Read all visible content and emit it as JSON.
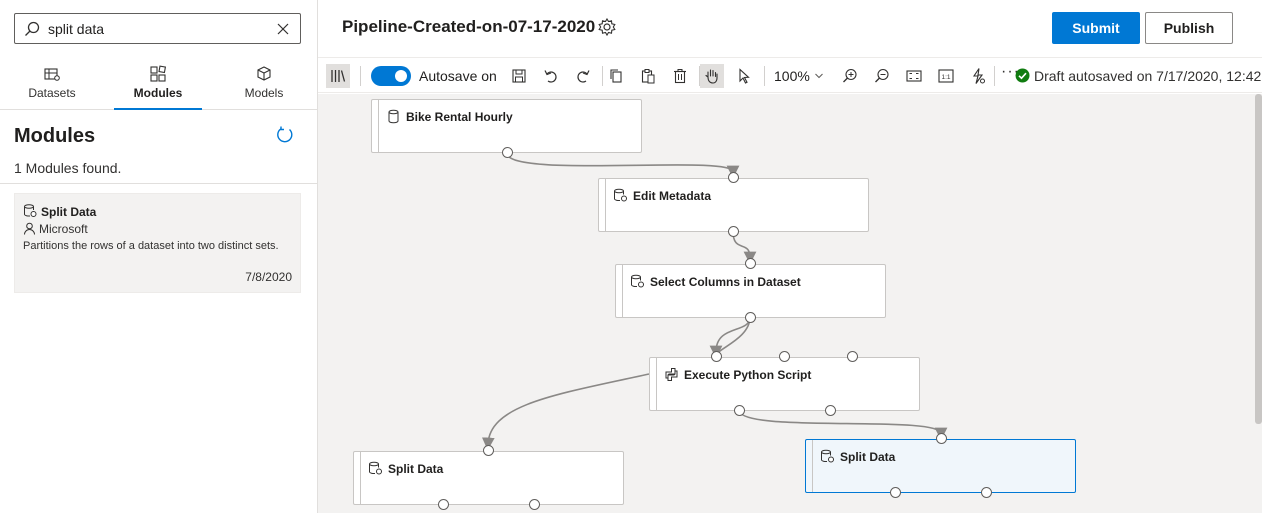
{
  "search": {
    "value": "split data"
  },
  "tabs": [
    {
      "label": "Datasets",
      "icon": "dataset-icon"
    },
    {
      "label": "Modules",
      "icon": "modules-icon"
    },
    {
      "label": "Models",
      "icon": "cube-icon"
    }
  ],
  "modules_panel": {
    "title": "Modules",
    "count_text": "1 Modules found.",
    "items": [
      {
        "name": "Split Data",
        "publisher": "Microsoft",
        "description": "Partitions the rows of a dataset into two distinct sets.",
        "date": "7/8/2020"
      }
    ]
  },
  "header": {
    "title": "Pipeline-Created-on-07-17-2020",
    "submit_label": "Submit",
    "publish_label": "Publish"
  },
  "toolbar": {
    "autosave_label": "Autosave on",
    "autosave_on": true,
    "zoom": "100%",
    "more": "···",
    "status": "Draft autosaved on 7/17/2020, 12:42"
  },
  "canvas": {
    "nodes": [
      {
        "id": "n1",
        "label": "Bike Rental Hourly",
        "icon": "dataset-icon"
      },
      {
        "id": "n2",
        "label": "Edit Metadata",
        "icon": "module-icon"
      },
      {
        "id": "n3",
        "label": "Select Columns in Dataset",
        "icon": "module-icon"
      },
      {
        "id": "n4",
        "label": "Execute Python Script",
        "icon": "python-icon"
      },
      {
        "id": "n5",
        "label": "Split Data",
        "icon": "module-icon"
      },
      {
        "id": "n6",
        "label": "Split Data",
        "icon": "module-icon",
        "selected": true
      }
    ]
  },
  "colors": {
    "accent": "#0078d4",
    "success": "#107c10",
    "canvas": "#f3f2f1"
  }
}
